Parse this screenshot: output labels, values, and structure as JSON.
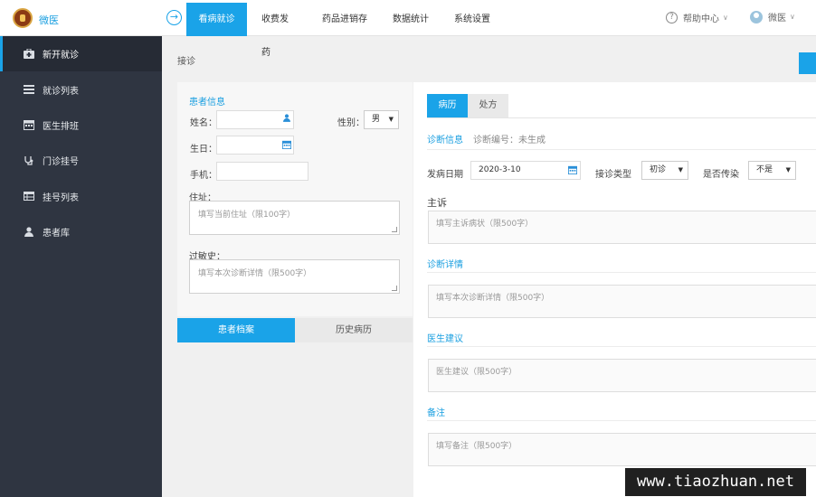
{
  "app": {
    "title": "微医"
  },
  "nav": {
    "items": [
      {
        "label": "看病就诊",
        "active": true
      },
      {
        "label": "收费发药"
      },
      {
        "label": "药品进销存"
      },
      {
        "label": "数据统计"
      },
      {
        "label": "系统设置"
      }
    ],
    "help": "帮助中心",
    "user": "微医"
  },
  "sidebar": {
    "items": [
      {
        "label": "新开就诊",
        "icon": "medical-kit-icon",
        "active": true
      },
      {
        "label": "就诊列表",
        "icon": "list-icon"
      },
      {
        "label": "医生排班",
        "icon": "calendar-icon"
      },
      {
        "label": "门诊挂号",
        "icon": "stethoscope-icon"
      },
      {
        "label": "挂号列表",
        "icon": "table-icon"
      },
      {
        "label": "患者库",
        "icon": "user-icon"
      }
    ]
  },
  "breadcrumb": "接诊",
  "patient": {
    "section_title": "患者信息",
    "name_label": "姓名：",
    "gender_label": "性别：",
    "gender_value": "男",
    "birthday_label": "生日：",
    "phone_label": "手机：",
    "address_label": "住址：",
    "address_placeholder": "填写当前住址（限100字）",
    "allergy_label": "过敏史：",
    "allergy_placeholder": "填写本次诊断详情（限500字）"
  },
  "bottom_tabs": [
    {
      "label": "患者档案",
      "active": true
    },
    {
      "label": "历史病历"
    }
  ],
  "record": {
    "tabs": [
      {
        "label": "病历",
        "active": true
      },
      {
        "label": "处方"
      }
    ],
    "diag_info": "诊断信息",
    "diag_no": "诊断编号：未生成",
    "onset_label": "发病日期",
    "onset_value": "2020-3-10",
    "visit_type_label": "接诊类型",
    "visit_type_value": "初诊",
    "contagious_label": "是否传染",
    "contagious_value": "不是",
    "complaint_label": "主诉",
    "complaint_placeholder": "填写主诉病状（限500字）",
    "diag_detail_title": "诊断详情",
    "diag_detail_placeholder": "填写本次诊断详情（限500字）",
    "advice_title": "医生建议",
    "advice_placeholder": "医生建议（限500字）",
    "remark_title": "备注",
    "remark_placeholder": "填写备注（限500字）"
  },
  "watermark": "www.tiaozhuan.net",
  "colors": {
    "accent": "#1aa3e8",
    "sidebar": "#2f3541"
  }
}
